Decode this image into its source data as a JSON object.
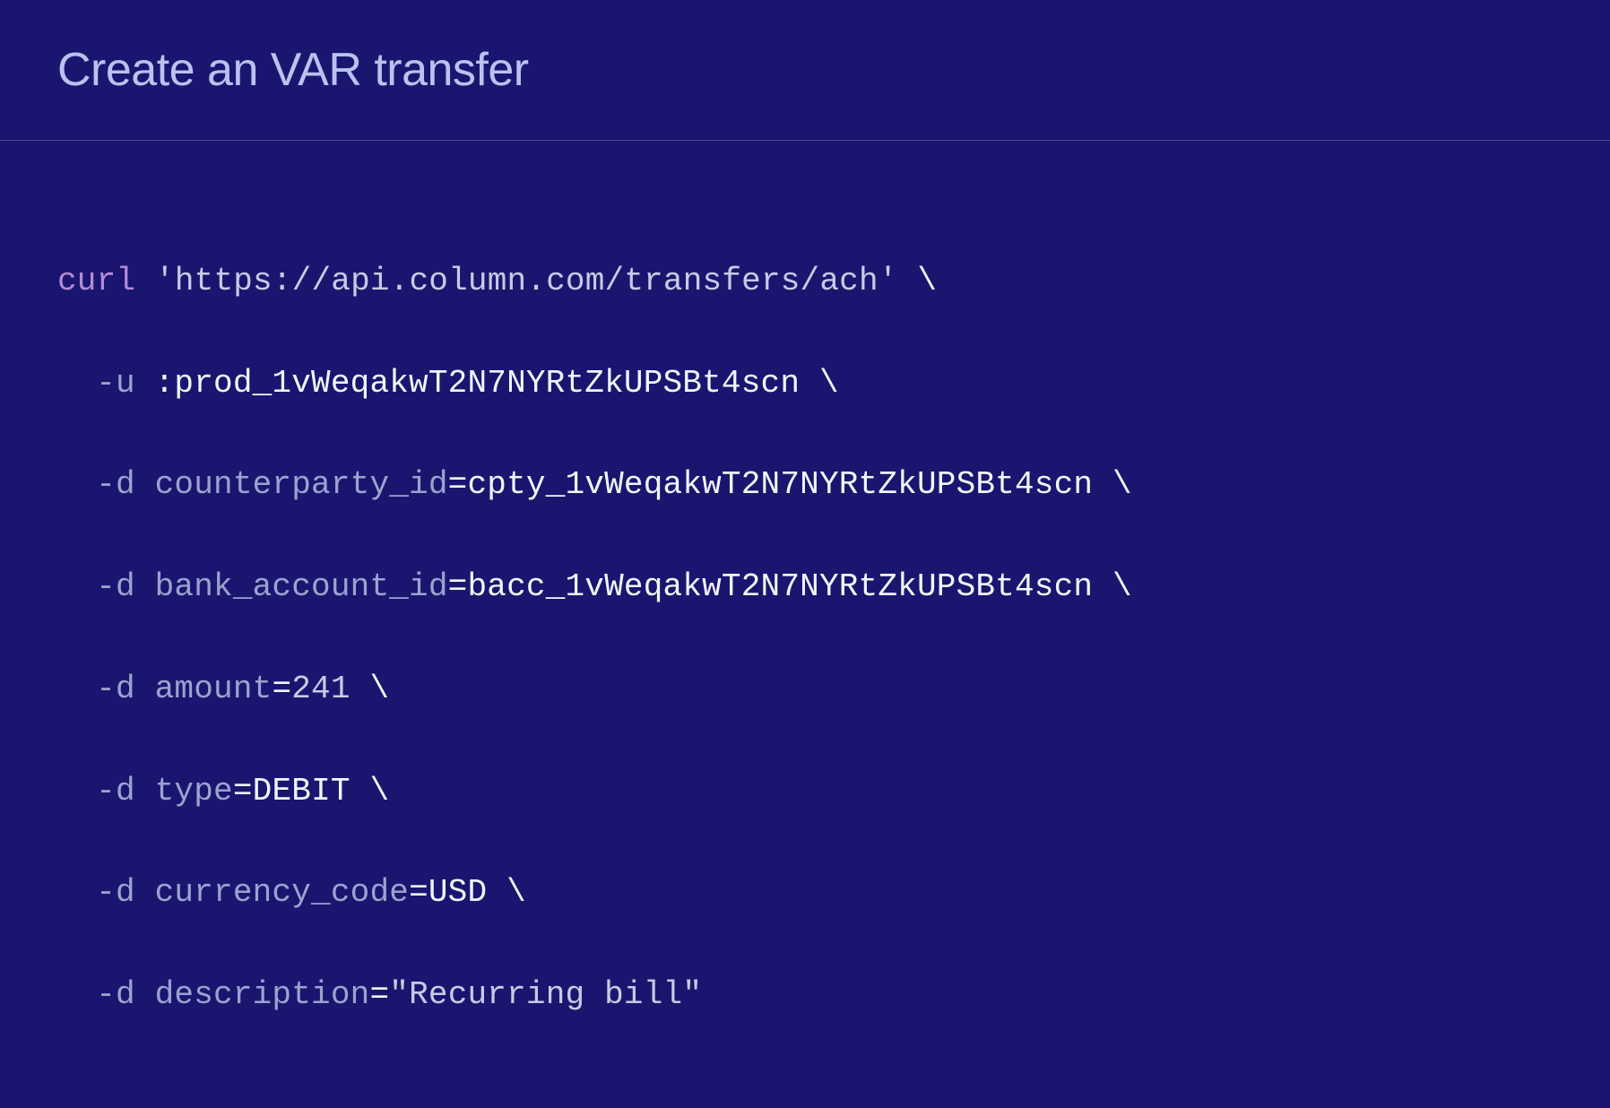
{
  "header": {
    "title": "Create an VAR transfer"
  },
  "code": {
    "command": "curl",
    "url": "'https://api.column.com/transfers/ach'",
    "cont": " \\",
    "lines": [
      {
        "flag": "-u",
        "key": "",
        "eq": "",
        "value": " :prod_1vWeqakwT2N7NYRtZkUPSBt4scn",
        "valueClass": "tok-val",
        "cont": " \\"
      },
      {
        "flag": "-d",
        "key": " counterparty_id",
        "eq": "=",
        "value": "cpty_1vWeqakwT2N7NYRtZkUPSBt4scn",
        "valueClass": "tok-val",
        "cont": " \\"
      },
      {
        "flag": "-d",
        "key": " bank_account_id",
        "eq": "=",
        "value": "bacc_1vWeqakwT2N7NYRtZkUPSBt4scn",
        "valueClass": "tok-val",
        "cont": " \\"
      },
      {
        "flag": "-d",
        "key": " amount",
        "eq": "=",
        "value": "241",
        "valueClass": "tok-strval",
        "cont": " \\"
      },
      {
        "flag": "-d",
        "key": " type",
        "eq": "=",
        "value": "DEBIT",
        "valueClass": "tok-val",
        "cont": " \\"
      },
      {
        "flag": "-d",
        "key": " currency_code",
        "eq": "=",
        "value": "USD",
        "valueClass": "tok-val",
        "cont": " \\"
      },
      {
        "flag": "-d",
        "key": " description",
        "eq": "=",
        "value": "\"Recurring bill\"",
        "valueClass": "tok-strval",
        "cont": ""
      }
    ]
  }
}
